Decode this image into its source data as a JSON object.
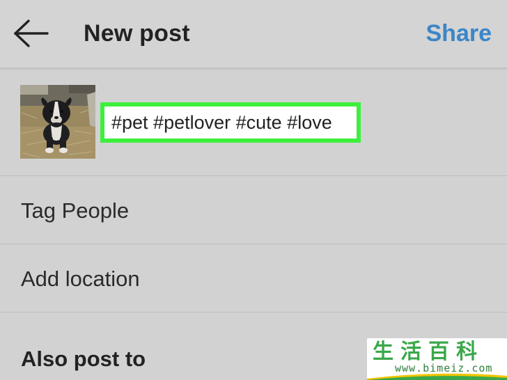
{
  "header": {
    "title": "New post",
    "share_label": "Share",
    "back_icon": "arrow-left-icon",
    "share_color": "#3a86c8"
  },
  "caption": {
    "text": "#pet #petlover #cute #love",
    "highlight_color": "#3df03d"
  },
  "thumbnail": {
    "subject": "black and white puppy on straw"
  },
  "rows": {
    "tag_people": "Tag People",
    "add_location": "Add location"
  },
  "section": {
    "also_post_to": "Also post to"
  },
  "watermark": {
    "logo": "生活百科",
    "url": "www.bimeiz.com"
  }
}
